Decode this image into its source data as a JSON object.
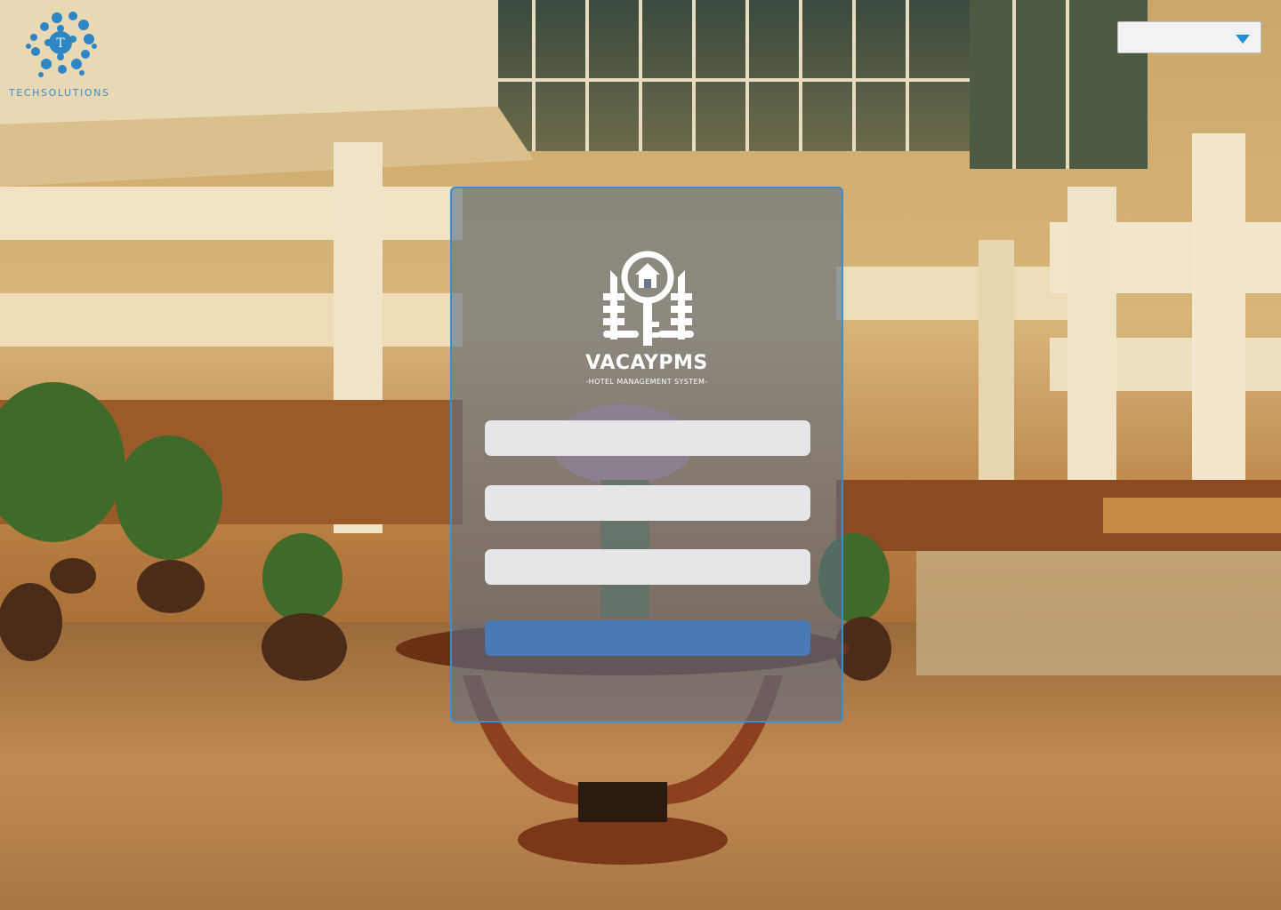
{
  "brand": {
    "name": "TECHSOLUTIONS",
    "logo_icon": "bubble-circle-logo-icon",
    "color": "#3d8fc6"
  },
  "language_select": {
    "value": "",
    "caret_icon": "caret-down-icon",
    "caret_color": "#1f8fd6"
  },
  "login": {
    "logo_icon": "hotel-key-icon",
    "app_name": "VACAYPMS",
    "tagline": "-HOTEL MANAGEMENT SYSTEM-",
    "fields": [
      {
        "value": "",
        "placeholder": ""
      },
      {
        "value": "",
        "placeholder": ""
      },
      {
        "value": "",
        "placeholder": ""
      }
    ],
    "submit_label": "",
    "accent_color": "#4a7ab5",
    "border_color": "#3a8fd0"
  }
}
